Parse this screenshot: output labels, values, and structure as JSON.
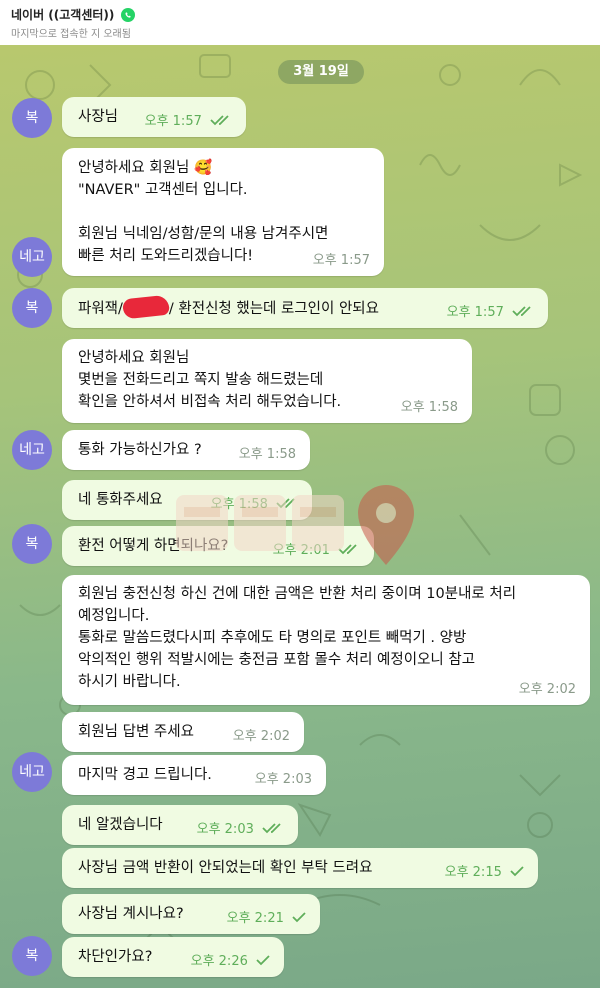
{
  "header": {
    "title": "네이버 ((고객센터))",
    "status": "마지막으로 접속한 지 오래됨"
  },
  "date": "3월 19일",
  "avatars": [
    {
      "label": "복",
      "color": "#7d7ad8"
    },
    {
      "label": "네고",
      "color": "#7d7ad8"
    },
    {
      "label": "복",
      "color": "#7d7ad8"
    },
    {
      "label": "네고",
      "color": "#7d7ad8"
    },
    {
      "label": "복",
      "color": "#7d7ad8"
    },
    {
      "label": "네고",
      "color": "#7d7ad8"
    },
    {
      "label": "복",
      "color": "#7d7ad8"
    }
  ],
  "messages": [
    {
      "text": "사장님",
      "time": "오후 1:57",
      "read": true
    },
    {
      "text": "안녕하세요 회원님 🥰\n\"NAVER\" 고객센터 입니다.\n\n회원님 닉네임/성함/문의 내용 남겨주시면\n빠른 처리 도와드리겠습니다!",
      "time": "오후 1:57",
      "read": false
    },
    {
      "text_before": "파워잭/",
      "text_after": "/ 환전신청 했는데 로그인이 안되요",
      "time": "오후 1:57",
      "read": true
    },
    {
      "text": "안녕하세요 회원님\n몇번을 전화드리고 쪽지 발송 해드렸는데\n확인을 안하셔서 비접속 처리 해두었습니다.",
      "time": "오후 1:58",
      "read": false
    },
    {
      "text": "통화 가능하신가요 ?",
      "time": "오후 1:58",
      "read": false
    },
    {
      "text": "네 통화주세요",
      "time": "오후 1:58",
      "read": true
    },
    {
      "text": "환전 어떻게 하면되나요?",
      "time": "오후 2:01",
      "read": true
    },
    {
      "text": "회원님 충전신청 하신 건에 대한 금액은 반환 처리 중이며 10분내로 처리\n예정입니다.\n통화로 말씀드렸다시피 추후에도 타 명의로 포인트 빼먹기 . 양방\n악의적인 행위 적발시에는 충전금 포함 몰수 처리 예정이오니 참고\n하시기 바랍니다.",
      "time": "오후 2:02",
      "read": false
    },
    {
      "text": "회원님 답변 주세요",
      "time": "오후 2:02",
      "read": false
    },
    {
      "text": "마지막 경고 드립니다.",
      "time": "오후 2:03",
      "read": false
    },
    {
      "text": "네 알겠습니다",
      "time": "오후 2:03",
      "read": true
    },
    {
      "text": "사장님 금액 반환이 안되었는데 확인 부탁 드려요",
      "time": "오후 2:15",
      "read": true
    },
    {
      "text": "사장님 계시나요?",
      "time": "오후 2:21",
      "read": true
    },
    {
      "text": "차단인가요?",
      "time": "오후 2:26",
      "read": true
    }
  ],
  "colors": {
    "incoming_bubble": "#ffffff",
    "outgoing_bubble": "#f0fbe2",
    "avatar": "#7d7ad8",
    "read_check": "#5fae5a",
    "whatsapp_icon": "#25d366"
  }
}
